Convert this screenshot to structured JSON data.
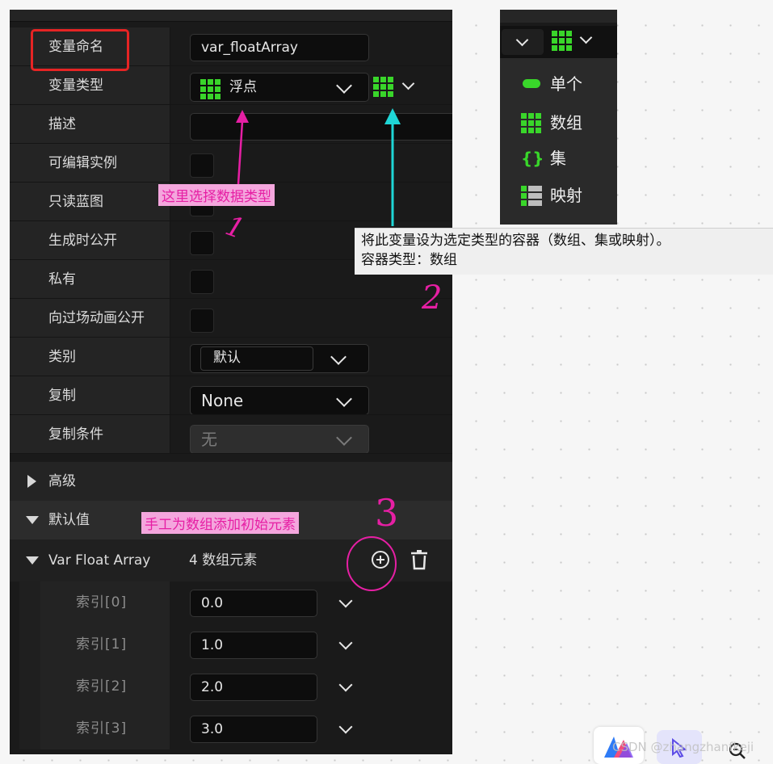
{
  "rows": {
    "var_name": {
      "label": "变量命名",
      "value": "var_floatArray"
    },
    "var_type": {
      "label": "变量类型",
      "type": "浮点"
    },
    "description": {
      "label": "描述",
      "value": ""
    },
    "editable": {
      "label": "可编辑实例"
    },
    "readonly": {
      "label": "只读蓝图"
    },
    "expose_spawn": {
      "label": "生成时公开"
    },
    "private": {
      "label": "私有"
    },
    "expose_cinematic": {
      "label": "向过场动画公开"
    },
    "category": {
      "label": "类别",
      "value": "默认"
    },
    "replication": {
      "label": "复制",
      "value": "None"
    },
    "rep_condition": {
      "label": "复制条件",
      "value": "无"
    }
  },
  "sections": {
    "advanced": "高级",
    "default_value": "默认值",
    "array_label": "Var Float Array",
    "array_count": "4 数组元素"
  },
  "elements": [
    {
      "label": "索引[0]",
      "value": "0.0"
    },
    {
      "label": "索引[1]",
      "value": "1.0"
    },
    {
      "label": "索引[2]",
      "value": "2.0"
    },
    {
      "label": "索引[3]",
      "value": "3.0"
    }
  ],
  "annotations": {
    "choose_type": "这里选择数据类型",
    "add_elements": "手工为数组添加初始元素",
    "num1": "1",
    "num2": "2",
    "num3": "3"
  },
  "container_menu": {
    "single": "单个",
    "array": "数组",
    "set": "集",
    "map": "映射"
  },
  "tooltip": {
    "line1": "将此变量设为选定类型的容器（数组、集或映射）。",
    "line2": "容器类型：数组"
  },
  "watermark": "CSDN @zhangzhanfkeji",
  "colors": {
    "accent_green": "#39d62a",
    "annotation_pink": "#e61fa4",
    "arrow_cyan": "#1fd6d6",
    "highlight_red": "#e62424"
  }
}
